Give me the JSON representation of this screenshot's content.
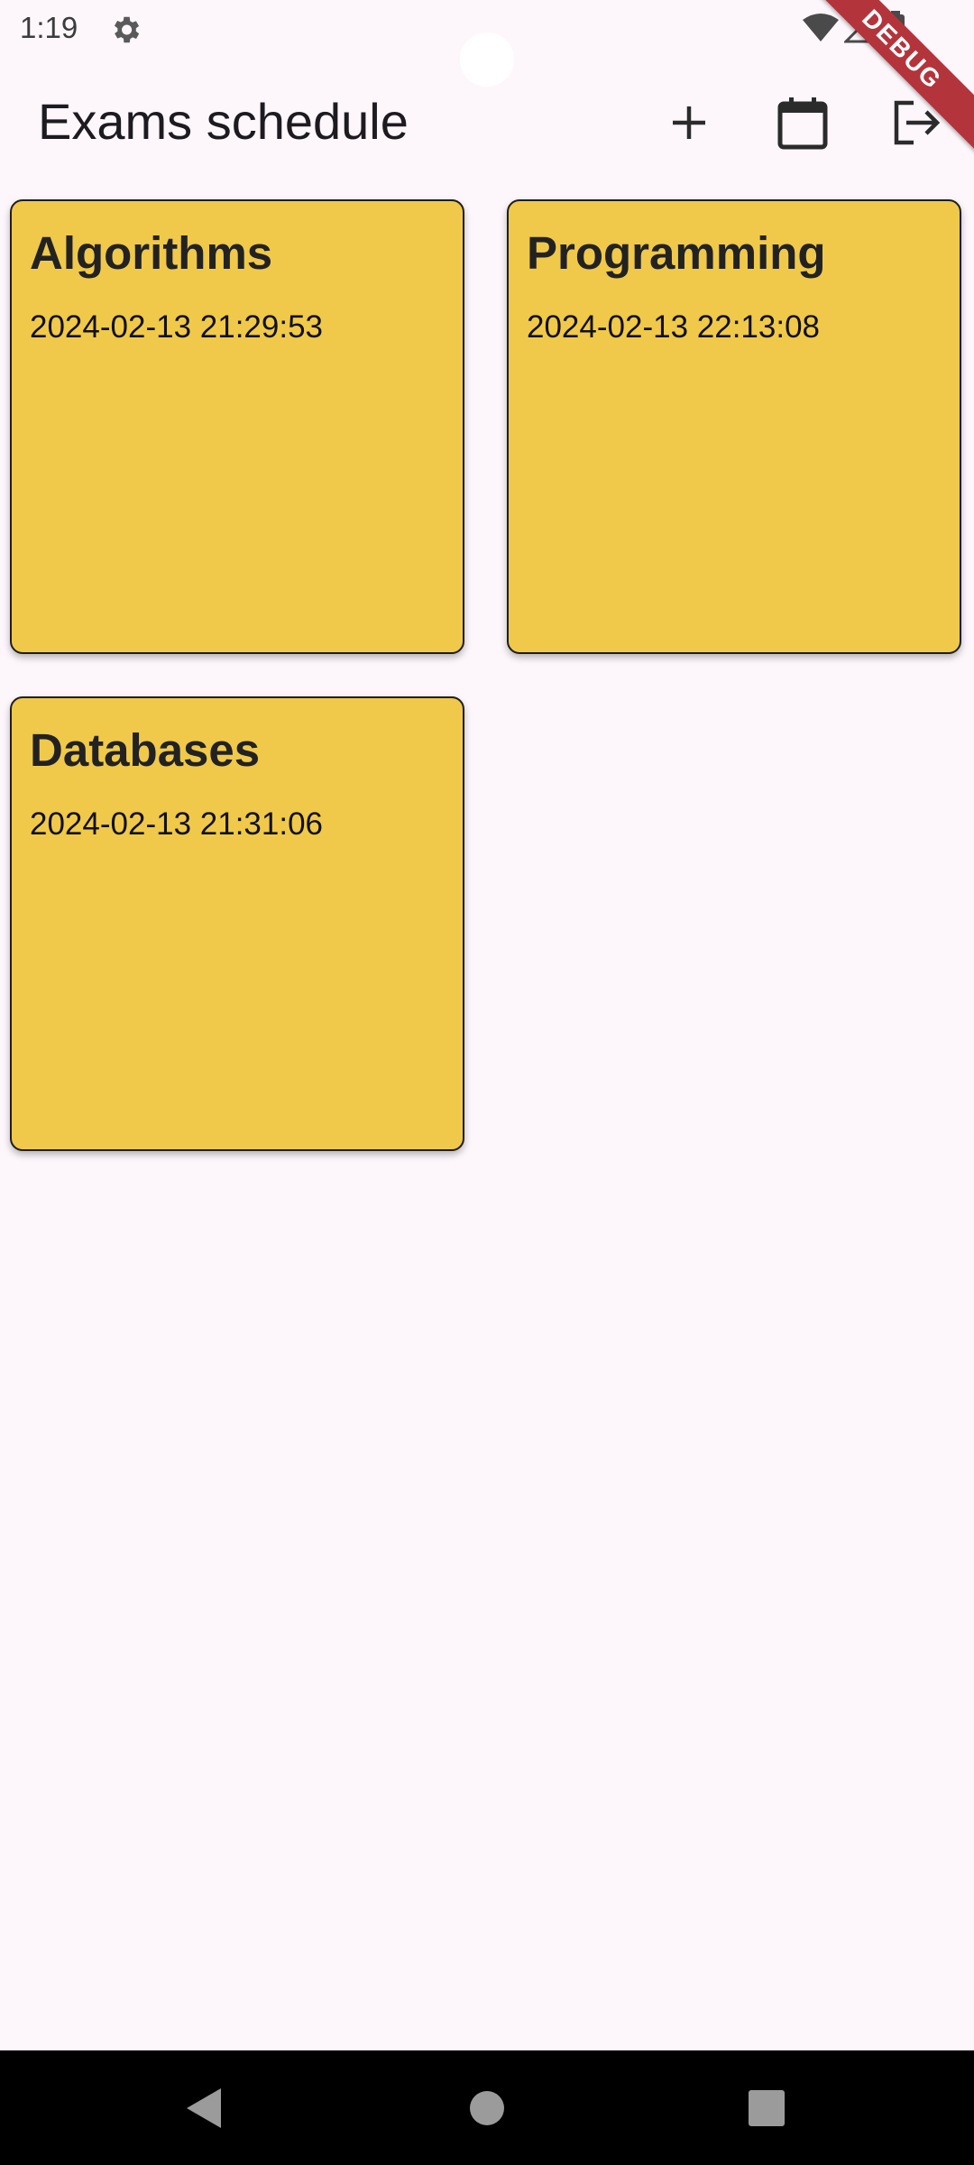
{
  "status_bar": {
    "time": "1:19",
    "debug_label": "DEBUG"
  },
  "app_bar": {
    "title": "Exams schedule"
  },
  "exams": [
    {
      "name": "Algorithms",
      "datetime": "2024-02-13 21:29:53"
    },
    {
      "name": "Programming",
      "datetime": "2024-02-13 22:13:08"
    },
    {
      "name": "Databases",
      "datetime": "2024-02-13 21:31:06"
    }
  ],
  "colors": {
    "card": "#f0c94a",
    "background": "#fdf7fc",
    "debug_ribbon": "#b4343c"
  },
  "icons": {
    "status": [
      "gear-icon",
      "wifi-icon",
      "signal-icon",
      "battery-icon"
    ],
    "app_bar": [
      "add-icon",
      "calendar-icon",
      "logout-icon"
    ],
    "nav": [
      "back-icon",
      "home-icon",
      "recents-icon"
    ]
  }
}
